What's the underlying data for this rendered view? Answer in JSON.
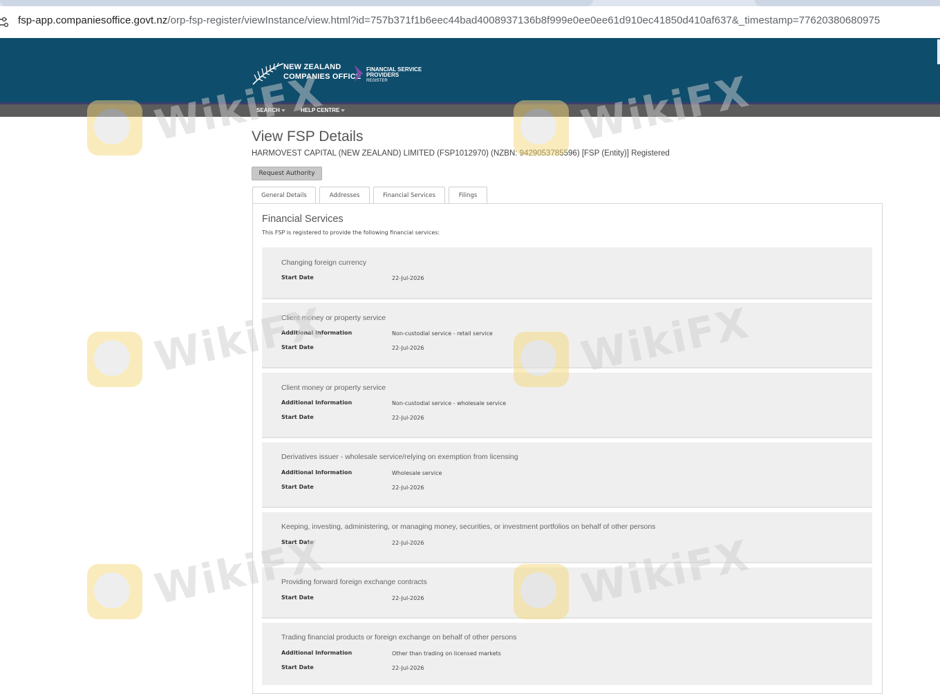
{
  "browser": {
    "url_host": "fsp-app.companiesoffice.govt.nz",
    "url_path": "/orp-fsp-register/viewInstance/view.html?id=757b371f1b6eec44bad4008937136b8f999e0ee0ee61d910ec41850d410af637&_timestamp=77620380680975"
  },
  "header": {
    "logo_line1": "NEW ZEALAND",
    "logo_line2": "COMPANIES OFFICE",
    "register_line1": "FINANCIAL SERVICE",
    "register_line2": "PROVIDERS",
    "register_line3": "REGISTER",
    "brand_color": "#0f4d6c"
  },
  "nav": {
    "search": "SEARCH",
    "help": "HELP CENTRE"
  },
  "page": {
    "title": "View FSP Details",
    "entity": "HARMOVEST CAPITAL (NEW ZEALAND) LIMITED (FSP1012970) (NZBN: 9429053785596) [FSP (Entity)] Registered",
    "request_authority": "Request Authority"
  },
  "tabs": [
    {
      "label": "General Details"
    },
    {
      "label": "Addresses"
    },
    {
      "label": "Financial Services"
    },
    {
      "label": "Filings"
    }
  ],
  "financial_services": {
    "heading": "Financial Services",
    "intro": "This FSP is registered to provide the following financial services:",
    "additional_label": "Additional Information",
    "start_label": "Start Date",
    "items": [
      {
        "title": "Changing foreign currency",
        "additional": null,
        "start": "22-Jul-2026"
      },
      {
        "title": "Client money or property service",
        "additional": "Non-custodial service - retail service",
        "start": "22-Jul-2026"
      },
      {
        "title": "Client money or property service",
        "additional": "Non-custodial service - wholesale service",
        "start": "22-Jul-2026"
      },
      {
        "title": "Derivatives issuer - wholesale service/relying on exemption from licensing",
        "additional": "Wholesale service",
        "start": "22-Jul-2026"
      },
      {
        "title": "Keeping, investing, administering, or managing money, securities, or investment portfolios on behalf of other persons",
        "additional": null,
        "start": "22-Jul-2026"
      },
      {
        "title": "Providing forward foreign exchange contracts",
        "additional": null,
        "start": "22-Jul-2026"
      },
      {
        "title": "Trading financial products or foreign exchange on behalf of other persons",
        "additional": "Other than trading on licensed markets",
        "start": "22-Jul-2026"
      }
    ]
  },
  "watermark": {
    "text": "WikiFX"
  }
}
